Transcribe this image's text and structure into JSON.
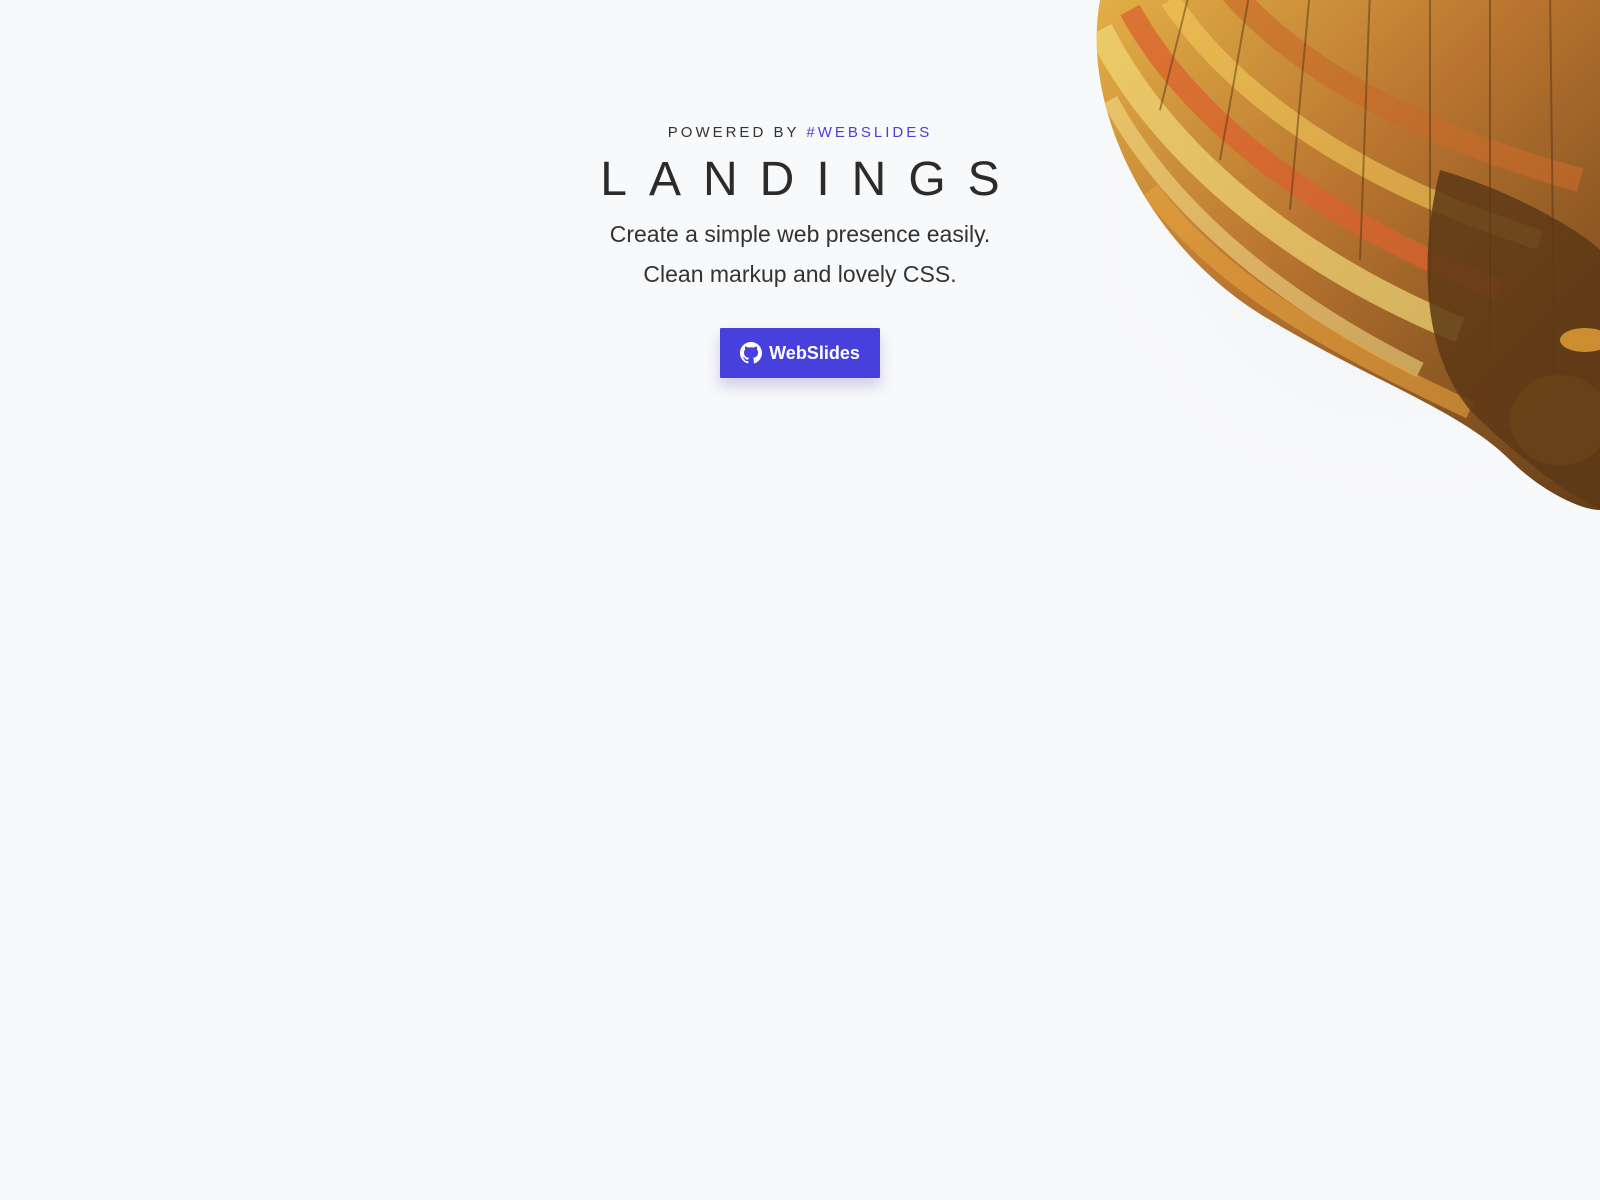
{
  "hero": {
    "powered_prefix": "POWERED BY",
    "powered_tag": "#WEBSLIDES",
    "title": "LANDINGS",
    "tagline_line1": "Create a simple web presence easily.",
    "tagline_line2": "Clean markup and lovely CSS."
  },
  "cta": {
    "label": "WebSlides",
    "icon": "github-icon"
  },
  "colors": {
    "background": "#f8f9fb",
    "accent": "#4740dc",
    "text": "#2b2b2b"
  },
  "decoration": {
    "image": "hot-air-balloon"
  }
}
